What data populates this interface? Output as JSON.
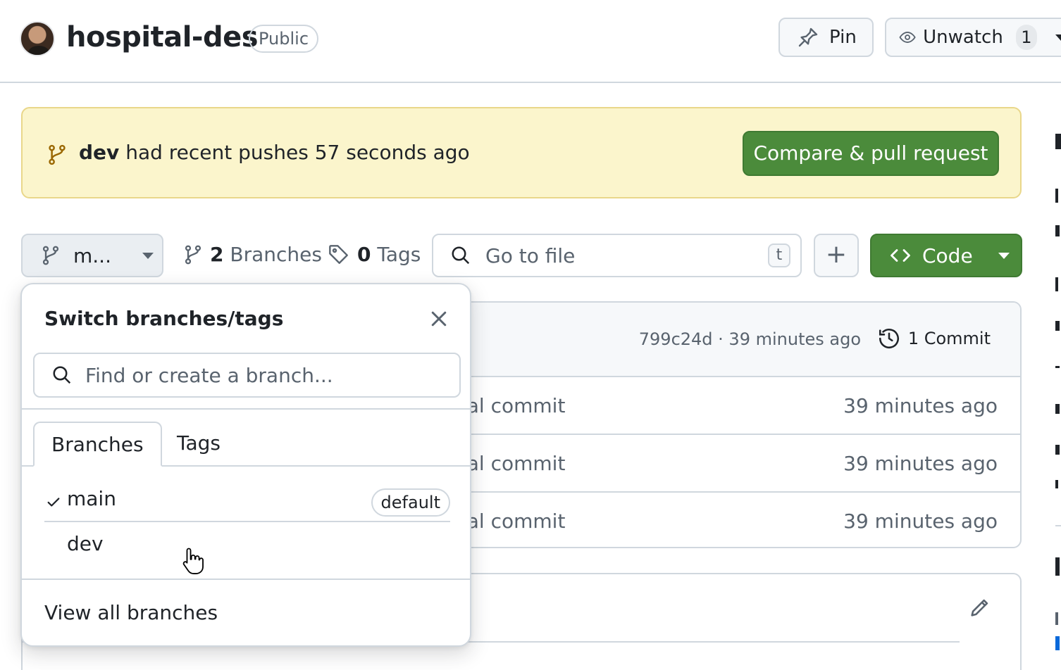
{
  "header": {
    "repo_name": "hospital-des",
    "visibility": "Public",
    "pin_label": "Pin",
    "watch_label": "Unwatch",
    "watch_count": "1"
  },
  "banner": {
    "branch": "dev",
    "message": " had recent pushes 57 seconds ago",
    "button": "Compare & pull request"
  },
  "toolbar": {
    "branch_button": "m...",
    "branches_count": "2",
    "branches_label": "Branches",
    "tags_count": "0",
    "tags_label": "Tags",
    "goto_placeholder": "Go to file",
    "goto_shortcut": "t",
    "add_label": "+",
    "code_label": "Code"
  },
  "commit_header": {
    "hash_time": "799c24d · 39 minutes ago",
    "commits": "1 Commit"
  },
  "files": [
    {
      "message": "tial commit",
      "time": "39 minutes ago"
    },
    {
      "message": "tial commit",
      "time": "39 minutes ago"
    },
    {
      "message": "tial commit",
      "time": "39 minutes ago"
    }
  ],
  "dropdown": {
    "title": "Switch branches/tags",
    "search_placeholder": "Find or create a branch...",
    "tabs": [
      "Branches",
      "Tags"
    ],
    "branches": [
      {
        "name": "main",
        "badge": "default",
        "selected": true
      },
      {
        "name": "dev",
        "badge": "",
        "selected": false
      }
    ],
    "view_all": "View all branches"
  },
  "colors": {
    "accent_green": "#4b8b3b",
    "banner_bg": "#fbf5cc",
    "border": "#d0d7de"
  }
}
